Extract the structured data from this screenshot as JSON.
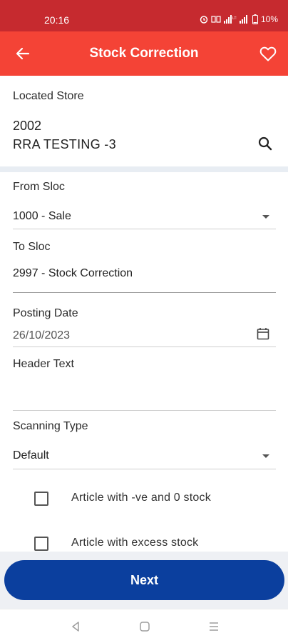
{
  "status_bar": {
    "time": "20:16",
    "battery": "10%"
  },
  "app_bar": {
    "title": "Stock Correction",
    "back_icon": "arrow-left-icon",
    "favorite_icon": "heart-outline-icon"
  },
  "located_store": {
    "label": "Located Store",
    "code": "2002",
    "name": "RRA TESTING -3",
    "search_icon": "search-icon"
  },
  "from_sloc": {
    "label": "From Sloc",
    "value": "1000 - Sale"
  },
  "to_sloc": {
    "label": "To Sloc",
    "value": "2997 - Stock Correction"
  },
  "posting_date": {
    "label": "Posting Date",
    "value": "26/10/2023",
    "icon": "calendar-icon"
  },
  "header_text": {
    "label": "Header Text",
    "value": ""
  },
  "scanning_type": {
    "label": "Scanning Type",
    "value": "Default"
  },
  "options": [
    {
      "label": "Article with -ve and 0 stock",
      "checked": false
    },
    {
      "label": "Article with excess stock",
      "checked": false
    }
  ],
  "next_button": {
    "label": "Next"
  },
  "colors": {
    "status_bar": "#c62a2f",
    "app_bar": "#f44336",
    "primary_button": "#0b3f9e",
    "section_band": "#e8edf3"
  }
}
